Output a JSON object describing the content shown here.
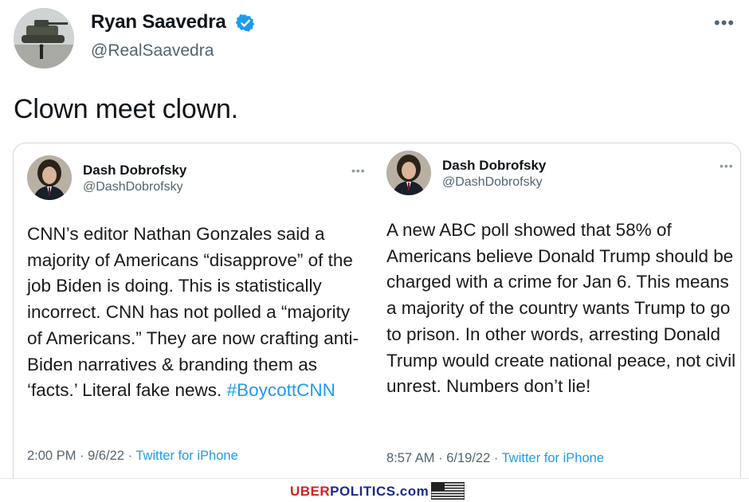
{
  "tweet": {
    "author_name": "Ryan Saavedra",
    "author_handle": "@RealSaavedra",
    "more_icon": "more-horizontal-icon",
    "text": "Clown meet clown."
  },
  "quotes": [
    {
      "author_name": "Dash Dobrofsky",
      "author_handle": "@DashDobrofsky",
      "body": "CNN’s editor Nathan Gonzales said a majority of Americans “disapprove” of the job Biden is doing. This is statistically incorrect. CNN has not polled a “majority of Americans.” They are now crafting anti-Biden narratives & branding them as ‘facts.’ Literal fake news.",
      "hashtag": "#BoycottCNN",
      "time": "2:00 PM · 9/6/22 · ",
      "source": "Twitter for iPhone"
    },
    {
      "author_name": "Dash Dobrofsky",
      "author_handle": "@DashDobrofsky",
      "body": "A new ABC poll showed that 58% of Americans believe Donald Trump should be charged with a crime for Jan 6. This means a majority of the country wants Trump to go to prison. In other words, arresting Donald Trump would create national peace, not civil unrest. Numbers don’t lie!",
      "time": "8:57 AM · 6/19/22 · ",
      "source": "Twitter for iPhone"
    }
  ],
  "watermark": {
    "uber": "UBER",
    "politics": "POLITICS",
    "domain": ".com"
  },
  "colors": {
    "link": "#1d9bf0",
    "verified": "#1d9bf0",
    "muted": "#536471"
  }
}
